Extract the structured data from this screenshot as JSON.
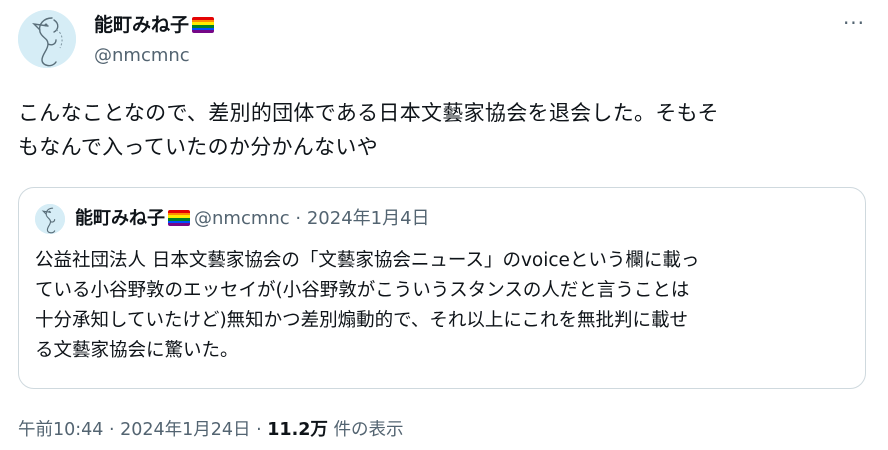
{
  "author": {
    "name": "能町みね子",
    "handle": "@nmcmnc",
    "flag_icon": "rainbow-flag-icon",
    "avatar_icon": "seahorse-sketch-avatar"
  },
  "more_icon": "more-options-icon",
  "more_label": "···",
  "post": {
    "text": "こんなことなので、差別的団体である日本文藝家協会を退会した。そもそ\nもなんで入っていたのか分かんないや"
  },
  "quote": {
    "name": "能町みね子",
    "handle_date": "@nmcmnc · 2024年1月4日",
    "text": "公益社団法人 日本文藝家協会の「文藝家協会ニュース」のvoiceという欄に載っ\nている小谷野敦のエッセイが(小谷野敦がこういうスタンスの人だと言うことは\n十分承知していたけど)無知かつ差別煽動的で、それ以上にこれを無批判に載せ\nる文藝家協会に驚いた。"
  },
  "footer": {
    "time_date": "午前10:44 · 2024年1月24日 · ",
    "views_count": "11.2万",
    "views_label": " 件の表示"
  },
  "colors": {
    "text_primary": "#0f1419",
    "text_secondary": "#536471",
    "border": "#cfd9de",
    "rainbow": [
      "#e40303",
      "#ff8c00",
      "#ffed00",
      "#008026",
      "#004dff",
      "#750787"
    ]
  }
}
